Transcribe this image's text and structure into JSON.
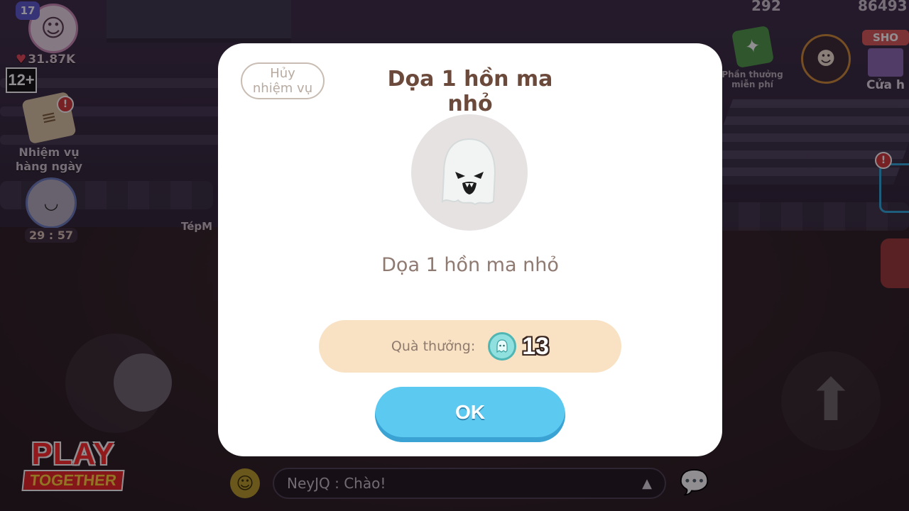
{
  "hud": {
    "level": "17",
    "likes": "31.87K",
    "age_rating": "12+",
    "daily_quest_label_line1": "Nhiệm vụ",
    "daily_quest_label_line2": "hàng ngày",
    "timer": "29 : 57",
    "nearby_player_name": "TépM",
    "top_number_1": "292",
    "top_number_2": "86493",
    "free_gift_line1": "Phần thưởng",
    "free_gift_line2": "miễn phí",
    "shop_sign": "SHO",
    "shop_label": "Cửa h",
    "alert_symbol": "!"
  },
  "modal": {
    "cancel_line1": "Hủy",
    "cancel_line2": "nhiệm vụ",
    "title": "Dọa 1 hồn ma nhỏ",
    "subtitle": "Dọa 1 hồn ma nhỏ",
    "reward_label": "Quà thưởng:",
    "reward_value": "13",
    "ok_label": "OK"
  },
  "logo": {
    "play": "PLAY",
    "together": "TOGETHER"
  },
  "chat": {
    "message": "NeyJQ : Chào!",
    "send_symbol": "▲"
  },
  "icons": {
    "emoji": "smiley-icon",
    "chat": "speech-bubble-icon",
    "jump": "up-arrow-icon",
    "reward_currency": "ghost-coin-icon"
  },
  "colors": {
    "ok_button": "#5cc9f0",
    "reward_bar": "#f9e2c4",
    "title": "#6b4a3c"
  }
}
